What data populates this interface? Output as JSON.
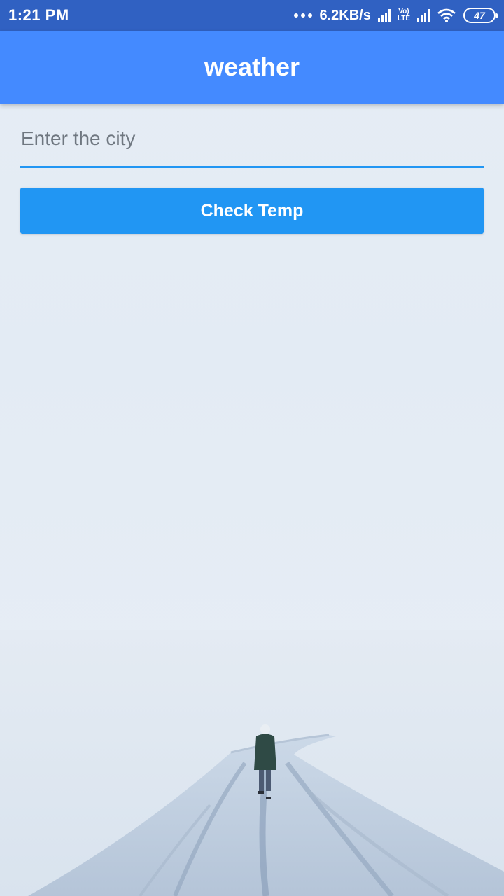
{
  "status_bar": {
    "time": "1:21 PM",
    "net_speed": "6.2KB/s",
    "lte_top": "Vo)",
    "lte_bottom": "LTE",
    "battery": "47"
  },
  "app_bar": {
    "title": "weather"
  },
  "form": {
    "city_value": "",
    "city_placeholder": "Enter the city",
    "check_button_label": "Check Temp"
  },
  "colors": {
    "status_bar": "#3061c2",
    "app_bar": "#448aff",
    "accent": "#2196f3",
    "background": "#e6edf5"
  },
  "icons": [
    "more-dots-icon",
    "signal-icon",
    "lte-icon",
    "wifi-icon",
    "battery-icon"
  ]
}
